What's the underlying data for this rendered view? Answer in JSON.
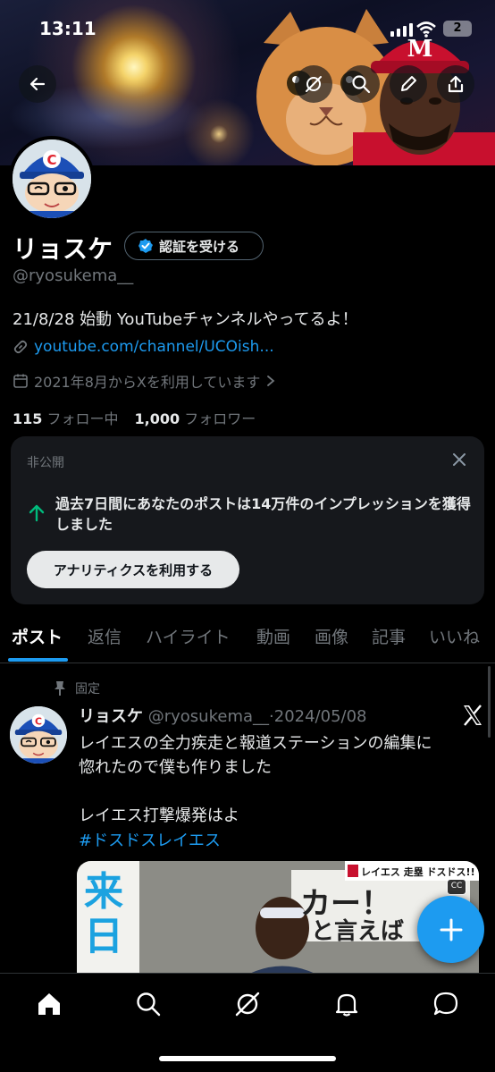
{
  "status_bar": {
    "time": "13:11",
    "battery": "2"
  },
  "header": {
    "back_icon": "arrow-left-icon",
    "actions": [
      "grok-icon",
      "search-icon",
      "edit-icon",
      "share-icon"
    ]
  },
  "profile": {
    "name": "リョスケ",
    "verify_label": "認証を受ける",
    "handle": "@ryosukema__",
    "bio": "21/8/28 始動 YouTubeチャンネルやってるよ！",
    "link": "youtube.com/channel/UCOish...",
    "joined": "2021年8月からXを利用しています",
    "following_count": "115",
    "following_label": "フォロー中",
    "followers_count": "1,000",
    "followers_label": "フォロワー"
  },
  "analytics_card": {
    "label": "非公開",
    "message": "過去7日間にあなたのポストは14万件のインプレッションを獲得しました",
    "button_label": "アナリティクスを利用する"
  },
  "tabs": [
    "ポスト",
    "返信",
    "ハイライト",
    "動画",
    "画像",
    "記事",
    "いいね"
  ],
  "active_tab": "ポスト",
  "pinned_post": {
    "pinned_label": "固定",
    "author": "リョスケ",
    "handle": "@ryosukema__",
    "separator": "·",
    "date": "2024/05/08",
    "text_line1": "レイエスの全力疾走と報道ステーションの編集に",
    "text_line2": "惚れたので僕も作りました",
    "text_line3": "レイエス打撃爆発はよ",
    "hashtag": "#ドスドスレイエス",
    "media_caption": "レイエス 走塁 ドスドス!!",
    "media_overlay_text1": "来日",
    "media_overlay_text2": "カー！",
    "media_overlay_text3": "と言えば",
    "cc_label": "CC"
  },
  "colors": {
    "accent": "#1d9bf0",
    "background": "#000000",
    "card_bg": "#16181c",
    "muted_text": "#71767b"
  },
  "bottom_nav": [
    "home-icon",
    "search-icon",
    "grok-icon",
    "bell-icon",
    "messages-icon"
  ]
}
